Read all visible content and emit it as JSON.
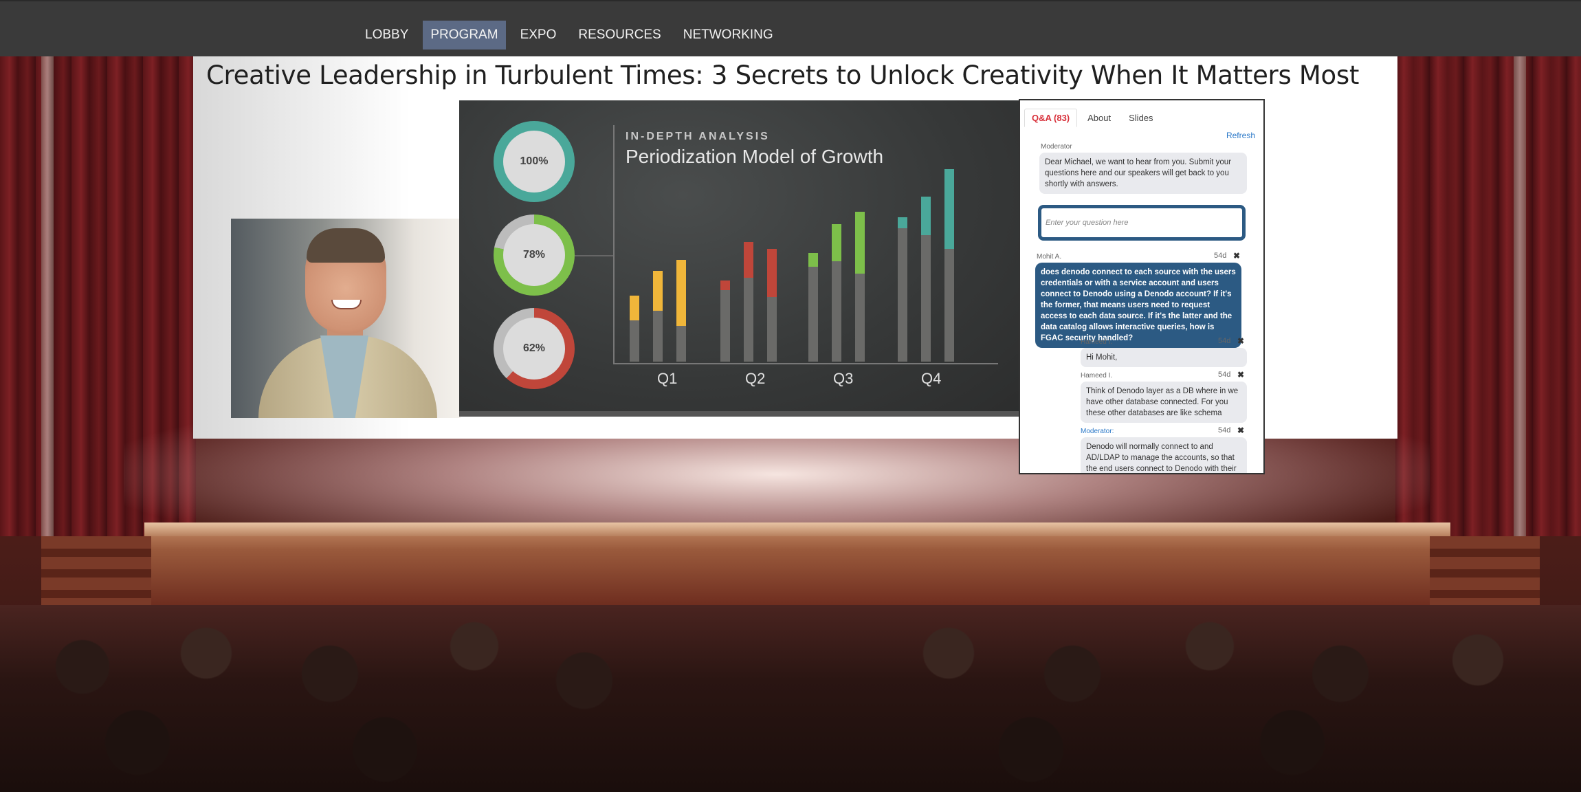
{
  "nav": {
    "items": [
      {
        "label": "LOBBY"
      },
      {
        "label": "PROGRAM",
        "active": true
      },
      {
        "label": "EXPO"
      },
      {
        "label": "RESOURCES"
      },
      {
        "label": "NETWORKING"
      }
    ],
    "active_color": "#5c6a85"
  },
  "session": {
    "title": "Creative Leadership in Turbulent Times: 3 Secrets to Unlock Creativity When It Matters Most"
  },
  "slide": {
    "kicker": "IN-DEPTH ANALYSIS",
    "title": "Periodization Model of Growth",
    "rings": [
      {
        "label": "100%",
        "value": 1.0,
        "color": "#4aa89a"
      },
      {
        "label": "78%",
        "value": 0.78,
        "color": "#7dbf4a"
      },
      {
        "label": "62%",
        "value": 0.62,
        "color": "#c0463a"
      }
    ],
    "quarters": [
      "Q1",
      "Q2",
      "Q3",
      "Q4"
    ]
  },
  "qa": {
    "tabs": [
      {
        "label": "Q&A (83)",
        "active": true
      },
      {
        "label": "About"
      },
      {
        "label": "Slides"
      }
    ],
    "refresh_label": "Refresh",
    "moderator_label": "Moderator",
    "moderator_message": "Dear Michael, we want to hear from you. Submit your questions here and our speakers will get back to you shortly with answers.",
    "input_placeholder": "Enter your question here",
    "question": {
      "author": "Mohit A.",
      "time": "54d",
      "text": "does denodo connect to each source with the users credentials or with a service account and users connect to Denodo using a Denodo account? If it's the former, that means users need to request access to each data source. If it's the latter and the data catalog allows interactive queries, how is FGAC security handled?"
    },
    "replies": [
      {
        "author": "Hameed I.",
        "time": "54d",
        "text": "Hi Mohit,"
      },
      {
        "author": "Hameed I.",
        "time": "54d",
        "text": "Think of Denodo layer as a DB where in we have other database connected. For you these other databases are like schema"
      },
      {
        "author": "Moderator:",
        "time": "54d",
        "text": "Denodo will normally connect to and AD/LDAP to manage the accounts, so that the end users connect to Denodo with their"
      }
    ]
  }
}
